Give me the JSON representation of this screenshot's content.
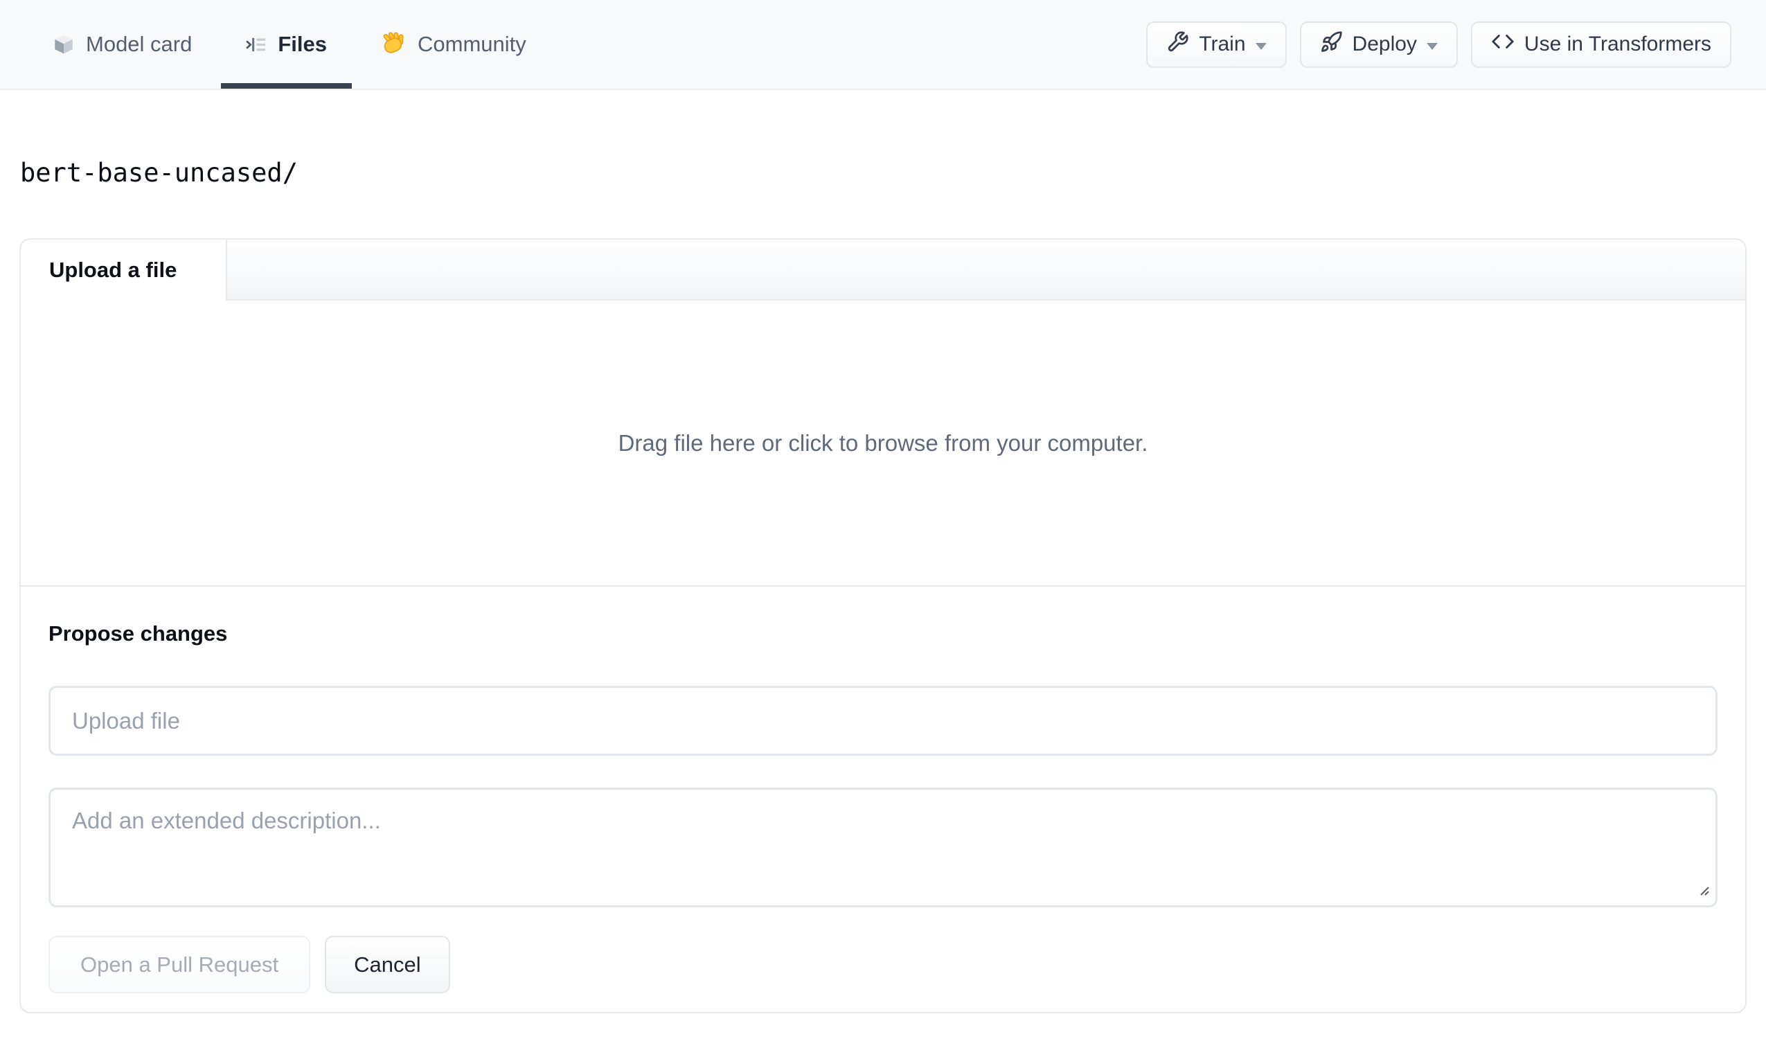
{
  "header": {
    "tabs": [
      {
        "label": "Model card",
        "icon": "cube-icon",
        "active": false
      },
      {
        "label": "Files",
        "icon": "file-tree-icon",
        "active": true
      },
      {
        "label": "Community",
        "icon": "waving-hand-icon",
        "active": false
      }
    ],
    "actions": [
      {
        "label": "Train",
        "icon": "wrench-icon",
        "has_dropdown": true
      },
      {
        "label": "Deploy",
        "icon": "rocket-icon",
        "has_dropdown": true
      },
      {
        "label": "Use in Transformers",
        "icon": "code-icon",
        "has_dropdown": false
      }
    ]
  },
  "repo": {
    "path": "bert-base-uncased/"
  },
  "upload_card": {
    "tab_label": "Upload a file",
    "dropzone_text": "Drag file here or click to browse from your computer.",
    "propose": {
      "heading": "Propose changes",
      "file_input_placeholder": "Upload file",
      "description_placeholder": "Add an extended description...",
      "open_pr_label": "Open a Pull Request",
      "cancel_label": "Cancel"
    }
  },
  "colors": {
    "active_tab_underline": "#39424f",
    "header_background": "#f8f9fb",
    "border": "#e7e9ec",
    "muted_text": "#99a1ae",
    "hand_emoji_fill": "#ffc83d",
    "hand_emoji_stroke": "#ef9f10"
  }
}
